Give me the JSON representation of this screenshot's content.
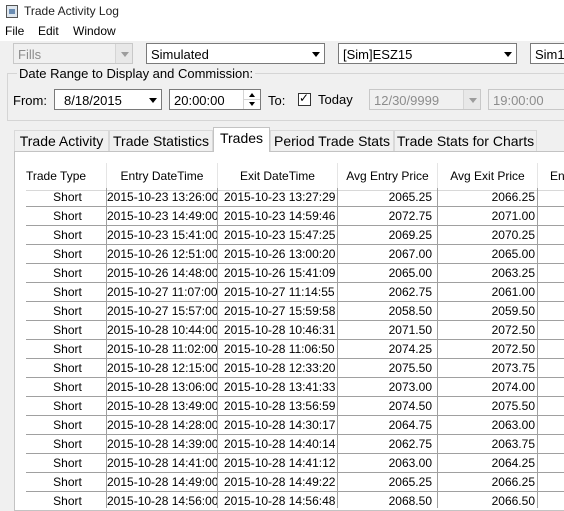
{
  "window": {
    "title": "Trade Activity Log"
  },
  "menu": [
    "File",
    "Edit",
    "Window"
  ],
  "toolbar": {
    "type_select": "Fills",
    "account_select": "Simulated",
    "symbol_select": "[Sim]ESZ15",
    "extra_select": "Sim1"
  },
  "date_range": {
    "legend": "Date Range to Display and Commission:",
    "from_label": "From:",
    "from_date": "8/18/2015",
    "from_time": "20:00:00",
    "to_label": "To:",
    "today_label": "Today",
    "today_checked": true,
    "to_date": "12/30/9999",
    "to_time": "19:00:00"
  },
  "tabs": [
    {
      "label": "Trade Activity",
      "active": false
    },
    {
      "label": "Trade Statistics",
      "active": false
    },
    {
      "label": "Trades",
      "active": true
    },
    {
      "label": "Period Trade Stats",
      "active": false
    },
    {
      "label": "Trade Stats for Charts",
      "active": false
    }
  ],
  "table": {
    "columns": [
      "Trade Type",
      "Entry DateTime",
      "Exit DateTime",
      "Avg Entry Price",
      "Avg Exit Price",
      "Ent"
    ],
    "rows": [
      [
        "Short",
        "2015-10-23  13:26:00",
        "2015-10-23  13:27:29",
        "2065.25",
        "2066.25"
      ],
      [
        "Short",
        "2015-10-23  14:49:00",
        "2015-10-23  14:59:46",
        "2072.75",
        "2071.00"
      ],
      [
        "Short",
        "2015-10-23  15:41:00",
        "2015-10-23  15:47:25",
        "2069.25",
        "2070.25"
      ],
      [
        "Short",
        "2015-10-26  12:51:00",
        "2015-10-26  13:00:20",
        "2067.00",
        "2065.00"
      ],
      [
        "Short",
        "2015-10-26  14:48:00",
        "2015-10-26  15:41:09",
        "2065.00",
        "2063.25"
      ],
      [
        "Short",
        "2015-10-27  11:07:00",
        "2015-10-27  11:14:55",
        "2062.75",
        "2061.00"
      ],
      [
        "Short",
        "2015-10-27  15:57:00",
        "2015-10-27  15:59:58",
        "2058.50",
        "2059.50"
      ],
      [
        "Short",
        "2015-10-28  10:44:00",
        "2015-10-28  10:46:31",
        "2071.50",
        "2072.50"
      ],
      [
        "Short",
        "2015-10-28  11:02:00",
        "2015-10-28  11:06:50",
        "2074.25",
        "2072.50"
      ],
      [
        "Short",
        "2015-10-28  12:15:00",
        "2015-10-28  12:33:20",
        "2075.50",
        "2073.75"
      ],
      [
        "Short",
        "2015-10-28  13:06:00",
        "2015-10-28  13:41:33",
        "2073.00",
        "2074.00"
      ],
      [
        "Short",
        "2015-10-28  13:49:00",
        "2015-10-28  13:56:59",
        "2074.50",
        "2075.50"
      ],
      [
        "Short",
        "2015-10-28  14:28:00",
        "2015-10-28  14:30:17",
        "2064.75",
        "2063.00"
      ],
      [
        "Short",
        "2015-10-28  14:39:00",
        "2015-10-28  14:40:14",
        "2062.75",
        "2063.75"
      ],
      [
        "Short",
        "2015-10-28  14:41:00",
        "2015-10-28  14:41:12",
        "2063.00",
        "2064.25"
      ],
      [
        "Short",
        "2015-10-28  14:49:00",
        "2015-10-28  14:49:22",
        "2065.25",
        "2066.25"
      ],
      [
        "Short",
        "2015-10-28  14:56:00",
        "2015-10-28  14:56:48",
        "2068.50",
        "2066.50"
      ]
    ]
  }
}
